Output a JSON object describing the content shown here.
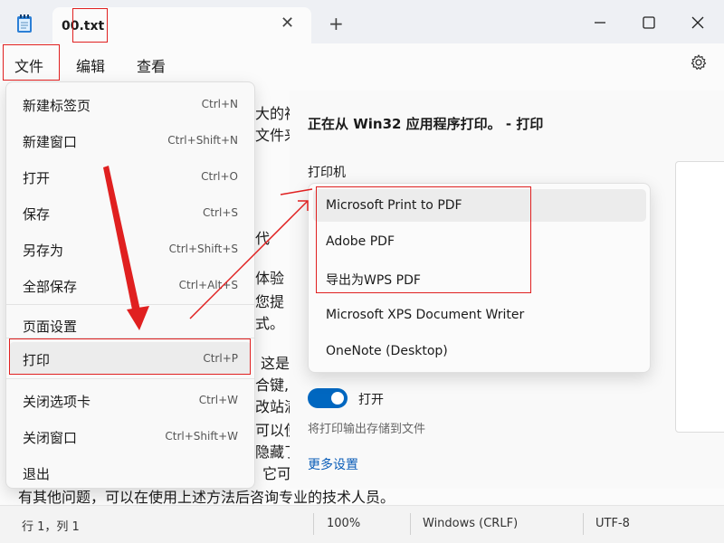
{
  "window": {
    "tab_title": "00.txt",
    "tab_close_glyph": "✕",
    "new_tab_glyph": "+"
  },
  "menubar": {
    "items": [
      "文件",
      "编辑",
      "查看"
    ]
  },
  "document": {
    "fragments": [
      "大的视",
      "文件来",
      "代",
      "体验",
      "您提",
      "式。",
      "这是",
      "合键,",
      "改站满",
      "可以使",
      "隐藏了",
      "它可",
      "有其他问题，可以在使用上述方法后咨询专业的技术人员。"
    ]
  },
  "file_menu": {
    "items": [
      {
        "label": "新建标签页",
        "shortcut": "Ctrl+N"
      },
      {
        "label": "新建窗口",
        "shortcut": "Ctrl+Shift+N"
      },
      {
        "label": "打开",
        "shortcut": "Ctrl+O"
      },
      {
        "label": "保存",
        "shortcut": "Ctrl+S"
      },
      {
        "label": "另存为",
        "shortcut": "Ctrl+Shift+S"
      },
      {
        "label": "全部保存",
        "shortcut": "Ctrl+Alt+S"
      },
      {
        "label": "页面设置",
        "shortcut": ""
      },
      {
        "label": "打印",
        "shortcut": "Ctrl+P"
      },
      {
        "label": "关闭选项卡",
        "shortcut": "Ctrl+W"
      },
      {
        "label": "关闭窗口",
        "shortcut": "Ctrl+Shift+W"
      },
      {
        "label": "退出",
        "shortcut": ""
      }
    ]
  },
  "print_dialog": {
    "title": "正在从 Win32 应用程序打印。 - 打印",
    "printer_label": "打印机",
    "printers": [
      "Microsoft Print to PDF",
      "Adobe PDF",
      "导出为WPS PDF",
      "Microsoft XPS Document Writer",
      "OneNote (Desktop)"
    ],
    "selected_printer": "Microsoft Print to PDF",
    "print_to_file_label": "打开",
    "print_to_file_on": true,
    "print_to_file_desc": "将打印输出存储到文件",
    "more_settings": "更多设置"
  },
  "status": {
    "position": "行 1，列 1",
    "zoom": "100%",
    "line_ending": "Windows (CRLF)",
    "encoding": "UTF-8"
  },
  "icons": {
    "app": "notepad-icon",
    "settings": "gear-icon",
    "minimize": "minimize-icon",
    "maximize": "maximize-icon",
    "close": "close-icon"
  },
  "colors": {
    "annotation": "#e02020",
    "accent": "#0067c0",
    "link": "#0a5db8"
  }
}
